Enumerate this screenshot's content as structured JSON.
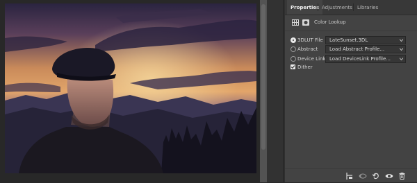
{
  "panel": {
    "tabs": [
      {
        "label": "Properties",
        "active": true
      },
      {
        "label": "Adjustments",
        "active": false
      },
      {
        "label": "Libraries",
        "active": false
      }
    ],
    "header": {
      "title": "Color Lookup",
      "icons": [
        "grid-icon",
        "mask-icon"
      ]
    },
    "options": [
      {
        "label": "3DLUT File",
        "value": "LateSunset.3DL",
        "selected": true
      },
      {
        "label": "Abstract",
        "value": "Load Abstract Profile...",
        "selected": false
      },
      {
        "label": "Device Link",
        "value": "Load DeviceLink Profile...",
        "selected": false
      }
    ],
    "dither": {
      "label": "Dither",
      "checked": true
    },
    "footer_icons": [
      "clip-to-layer-icon",
      "view-previous-icon",
      "reset-icon",
      "visibility-icon",
      "trash-icon"
    ]
  },
  "canvas": {
    "description_image": "photo"
  },
  "colors": {
    "panel_bg": "#434343",
    "tab_bar_bg": "#383838",
    "workspace_bg": "#282828"
  }
}
